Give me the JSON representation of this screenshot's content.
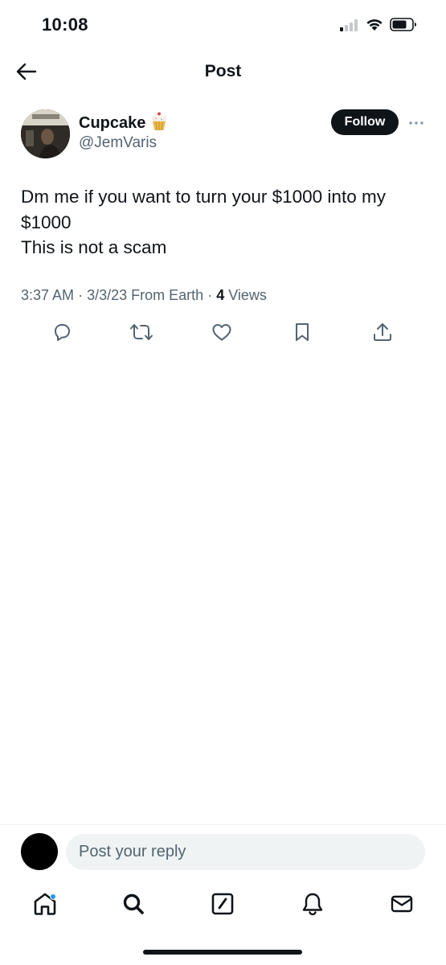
{
  "status_bar": {
    "time": "10:08",
    "icons": [
      "cellular-signal-icon",
      "wifi-icon",
      "battery-icon"
    ]
  },
  "header": {
    "title": "Post",
    "back_icon": "arrow-left-icon"
  },
  "author": {
    "name": "Cupcake",
    "emoji": "🧁",
    "handle": "@JemVaris",
    "follow_label": "Follow",
    "more_icon": "more-dots-icon"
  },
  "tweet": {
    "lines": [
      "Dm me if you want to turn your $1000 into my",
      "$1000",
      "This is not a scam"
    ]
  },
  "meta": {
    "time": "3:37 AM",
    "date": "3/3/23",
    "source": "From Earth",
    "views_count": "4",
    "views_label": "Views"
  },
  "actions": [
    "reply-icon",
    "retweet-icon",
    "like-icon",
    "bookmark-icon",
    "share-icon"
  ],
  "reply": {
    "placeholder": "Post your reply"
  },
  "bottom_nav": [
    "home-icon",
    "search-icon",
    "compose-icon",
    "notifications-icon",
    "messages-icon"
  ],
  "colors": {
    "text": "#0f1419",
    "secondary_text": "#536471",
    "accent": "#1d9bf0",
    "input_bg": "#eff3f4"
  }
}
